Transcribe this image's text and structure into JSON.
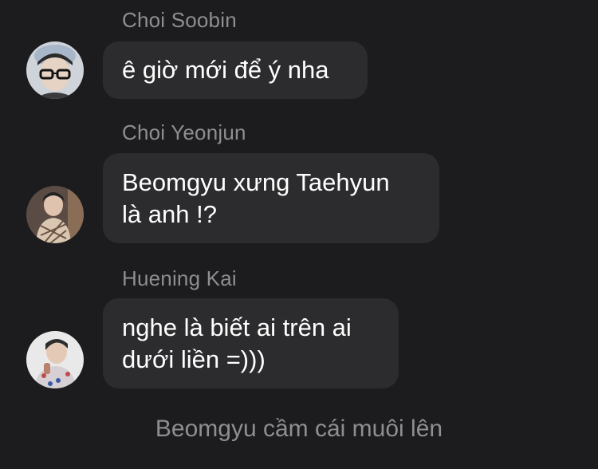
{
  "messages": [
    {
      "sender": "Choi Soobin",
      "lines": [
        "ê giờ mới để ý nha"
      ],
      "avatar_icon": "avatar-photo"
    },
    {
      "sender": "Choi Yeonjun",
      "lines": [
        "Beomgyu xưng Taehyun",
        "là anh !?"
      ],
      "avatar_icon": "avatar-photo"
    },
    {
      "sender": "Huening Kai",
      "lines": [
        "nghe là biết ai trên ai",
        "dưới liền =)))"
      ],
      "avatar_icon": "avatar-photo"
    }
  ],
  "system_message": "Beomgyu cầm cái muôi lên",
  "colors": {
    "background": "#1c1c1e",
    "bubble": "#2c2c2e",
    "sender_name": "#8e8e93",
    "message_text": "#ffffff"
  }
}
